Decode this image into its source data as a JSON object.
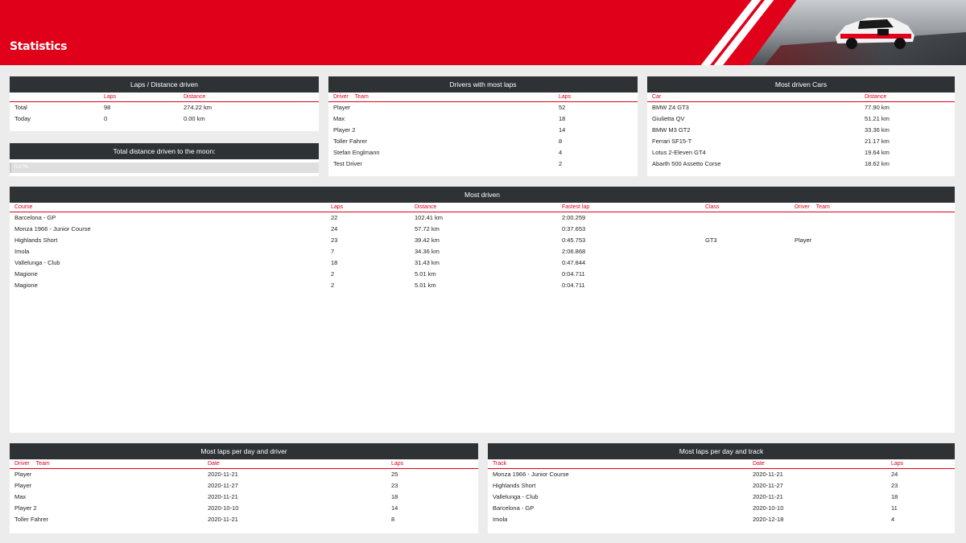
{
  "header": {
    "title": "Statistics"
  },
  "laps_distance": {
    "title": "Laps / Distance driven",
    "columns": [
      "Laps",
      "Distance"
    ],
    "rows": [
      {
        "label": "Total",
        "laps": "98",
        "distance": "274.22 km"
      },
      {
        "label": "Today",
        "laps": "0",
        "distance": "0.00 km"
      }
    ]
  },
  "moon": {
    "title": "Total distance driven to the moon:",
    "progress_text": "0.07%",
    "progress_fraction": 0.0007
  },
  "drivers": {
    "title": "Drivers with most laps",
    "col_driver": "Driver",
    "col_team": "Team",
    "col_laps": "Laps",
    "rows": [
      {
        "driver": "Player",
        "laps": "52"
      },
      {
        "driver": "Max",
        "laps": "18"
      },
      {
        "driver": "Player 2",
        "laps": "14"
      },
      {
        "driver": "Toller Fahrer",
        "laps": "8"
      },
      {
        "driver": "Stefan Englmann",
        "laps": "4"
      },
      {
        "driver": "Test Driver",
        "laps": "2"
      }
    ]
  },
  "cars": {
    "title": "Most driven Cars",
    "col_car": "Car",
    "col_distance": "Distance",
    "rows": [
      {
        "car": "BMW Z4 GT3",
        "distance": "77.90 km"
      },
      {
        "car": "Giulietta QV",
        "distance": "51.21 km"
      },
      {
        "car": "BMW M3 GT2",
        "distance": "33.36 km"
      },
      {
        "car": "Ferrari SF15-T",
        "distance": "21.17 km"
      },
      {
        "car": "Lotus 2-Eleven GT4",
        "distance": "19.64 km"
      },
      {
        "car": "Abarth 500 Assetto Corse",
        "distance": "18.62 km"
      }
    ]
  },
  "most_driven": {
    "title": "Most driven",
    "col_course": "Course",
    "col_laps": "Laps",
    "col_distance": "Distance",
    "col_fastest": "Fastest lap",
    "col_class": "Class",
    "col_driver": "Driver",
    "col_team": "Team",
    "rows": [
      {
        "course": "Barcelona - GP",
        "laps": "22",
        "distance": "102.41 km",
        "fastest": "2:00.259",
        "class": "",
        "driver": ""
      },
      {
        "course": "Monza 1966 - Junior Course",
        "laps": "24",
        "distance": "57.72 km",
        "fastest": "0:37.653",
        "class": "",
        "driver": ""
      },
      {
        "course": "Highlands Short",
        "laps": "23",
        "distance": "39.42 km",
        "fastest": "0:45.753",
        "class": "GT3",
        "driver": "Player"
      },
      {
        "course": "Imola",
        "laps": "7",
        "distance": "34.36 km",
        "fastest": "2:06.868",
        "class": "",
        "driver": ""
      },
      {
        "course": "Vallelunga - Club",
        "laps": "18",
        "distance": "31.43 km",
        "fastest": "0:47.844",
        "class": "",
        "driver": ""
      },
      {
        "course": "Magione",
        "laps": "2",
        "distance": "5.01 km",
        "fastest": "0:04.711",
        "class": "",
        "driver": ""
      },
      {
        "course": "Magione",
        "laps": "2",
        "distance": "5.01 km",
        "fastest": "0:04.711",
        "class": "",
        "driver": ""
      }
    ]
  },
  "per_day_driver": {
    "title": "Most laps per day and driver",
    "col_driver": "Driver",
    "col_team": "Team",
    "col_date": "Date",
    "col_laps": "Laps",
    "rows": [
      {
        "driver": "Player",
        "date": "2020-11-21",
        "laps": "25"
      },
      {
        "driver": "Player",
        "date": "2020-11-27",
        "laps": "23"
      },
      {
        "driver": "Max",
        "date": "2020-11-21",
        "laps": "18"
      },
      {
        "driver": "Player 2",
        "date": "2020-10-10",
        "laps": "14"
      },
      {
        "driver": "Toller Fahrer",
        "date": "2020-11-21",
        "laps": "8"
      }
    ]
  },
  "per_day_track": {
    "title": "Most laps per day and track",
    "col_track": "Track",
    "col_date": "Date",
    "col_laps": "Laps",
    "rows": [
      {
        "track": "Monza 1966 - Junior Course",
        "date": "2020-11-21",
        "laps": "24"
      },
      {
        "track": "Highlands Short",
        "date": "2020-11-27",
        "laps": "23"
      },
      {
        "track": "Vallelunga - Club",
        "date": "2020-11-21",
        "laps": "18"
      },
      {
        "track": "Barcelona - GP",
        "date": "2020-10-10",
        "laps": "11"
      },
      {
        "track": "Imola",
        "date": "2020-12-18",
        "laps": "4"
      }
    ]
  }
}
